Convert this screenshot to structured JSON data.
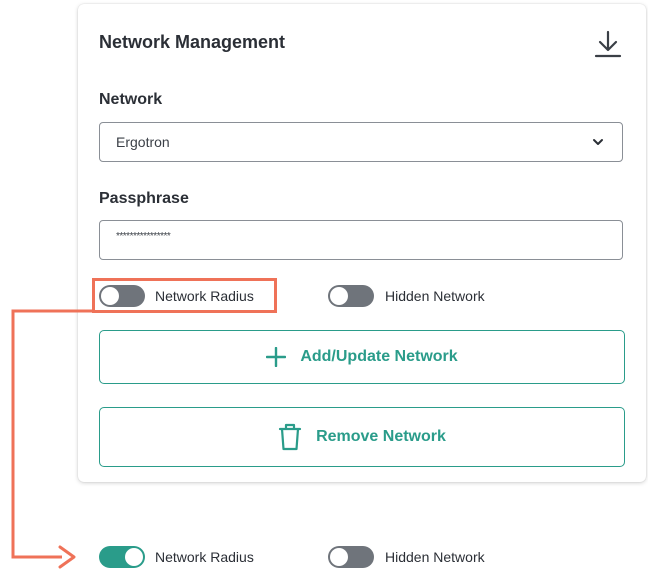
{
  "card": {
    "title": "Network Management",
    "network_label": "Network",
    "network_value": "Ergotron",
    "passphrase_label": "Passphrase",
    "passphrase_value": "****************",
    "toggles": {
      "network_radius": {
        "label": "Network Radius",
        "on": false
      },
      "hidden_network": {
        "label": "Hidden Network",
        "on": false
      }
    },
    "add_update_label": "Add/Update Network",
    "remove_label": "Remove Network"
  },
  "after": {
    "toggles": {
      "network_radius": {
        "label": "Network Radius",
        "on": true
      },
      "hidden_network": {
        "label": "Hidden Network",
        "on": false
      }
    }
  },
  "icons": {
    "download": "download-icon",
    "chevron": "chevron-down-icon",
    "plus": "plus-icon",
    "trash": "trash-icon"
  },
  "colors": {
    "accent": "#2a9c8a",
    "toggle_off": "#6f747b",
    "highlight": "#ef7258"
  }
}
